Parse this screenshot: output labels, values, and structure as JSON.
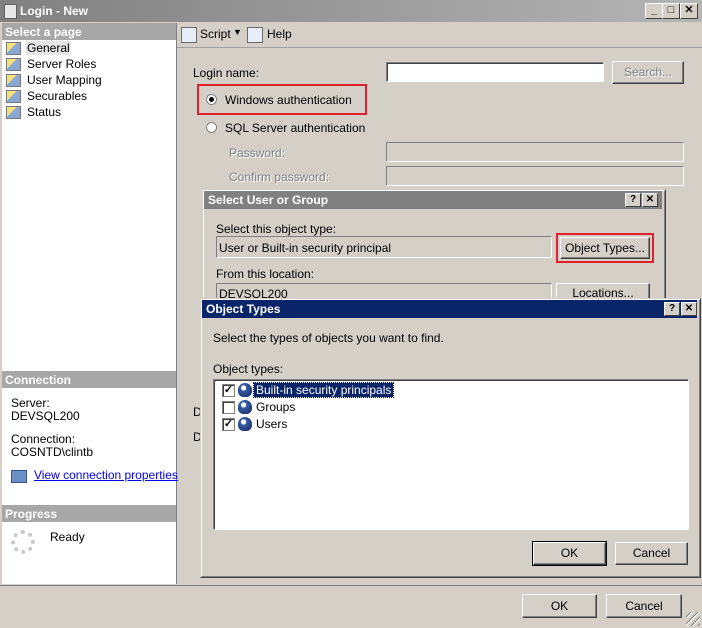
{
  "window": {
    "title": "Login - New",
    "minimize": "_",
    "maximize": "□",
    "close": "✕"
  },
  "left": {
    "select_page": "Select a page",
    "pages": [
      "General",
      "Server Roles",
      "User Mapping",
      "Securables",
      "Status"
    ],
    "connection_header": "Connection",
    "server_label": "Server:",
    "server_value": "DEVSQL200",
    "connection_label": "Connection:",
    "connection_value": "COSNTD\\clintb",
    "view_props": "View connection properties",
    "progress_header": "Progress",
    "progress_status": "Ready"
  },
  "toolbar": {
    "script": "Script",
    "help": "Help"
  },
  "general": {
    "login_name_label": "Login name:",
    "login_name_value": "",
    "search_button": "Search...",
    "windows_auth": "Windows authentication",
    "sql_auth": "SQL Server authentication",
    "password_label": "Password:",
    "confirm_label": "Confirm password:",
    "hidden_label_1": "D",
    "hidden_label_2": "D"
  },
  "select_dialog": {
    "title": "Select User or Group",
    "help": "?",
    "close": "✕",
    "object_type_label": "Select this object type:",
    "object_type_value": "User or Built-in security principal",
    "object_types_button": "Object Types...",
    "location_label": "From this location:",
    "location_value": "DEVSQL200",
    "locations_button": "Locations..."
  },
  "types_dialog": {
    "title": "Object Types",
    "help": "?",
    "close": "✕",
    "instruction": "Select the types of objects you want to find.",
    "list_label": "Object types:",
    "items": [
      {
        "label": "Built-in security principals",
        "checked": true
      },
      {
        "label": "Groups",
        "checked": false
      },
      {
        "label": "Users",
        "checked": true
      }
    ],
    "ok": "OK",
    "cancel": "Cancel"
  },
  "footer": {
    "ok": "OK",
    "cancel": "Cancel"
  },
  "colors": {
    "active_title": "#0a246a",
    "selection": "#0a246a",
    "highlight_box": "#e0202a"
  }
}
